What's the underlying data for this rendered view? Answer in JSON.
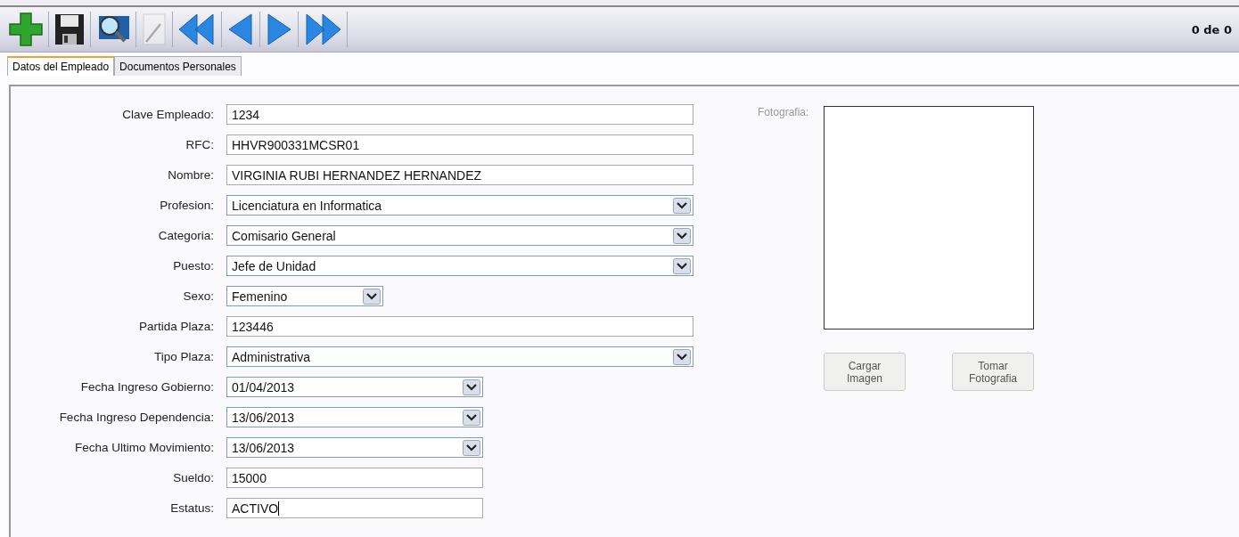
{
  "toolbar": {
    "buttons": [
      {
        "kind": "add",
        "disabled": false
      },
      {
        "kind": "save",
        "disabled": false
      },
      {
        "kind": "search",
        "disabled": false
      },
      {
        "kind": "edit",
        "disabled": true
      },
      {
        "kind": "first",
        "disabled": false
      },
      {
        "kind": "prev",
        "disabled": false
      },
      {
        "kind": "next",
        "disabled": false
      },
      {
        "kind": "last",
        "disabled": false
      }
    ],
    "record_counter": "0 de 0"
  },
  "tabs": [
    {
      "label": "Datos del Empleado",
      "selected": true
    },
    {
      "label": "Documentos Personales",
      "selected": false
    }
  ],
  "fields": [
    {
      "label": "Clave Empleado:",
      "value": "1234",
      "kind": "text",
      "focused": false
    },
    {
      "label": "RFC:",
      "value": "HHVR900331MCSR01",
      "kind": "text",
      "focused": false
    },
    {
      "label": "Nombre:",
      "value": "VIRGINIA RUBI HERNANDEZ HERNANDEZ",
      "kind": "text",
      "focused": false
    },
    {
      "label": "Profesion:",
      "value": "Licenciatura en Informatica",
      "kind": "combo"
    },
    {
      "label": "Categoria:",
      "value": "Comisario General",
      "kind": "combo"
    },
    {
      "label": "Puesto:",
      "value": "Jefe de Unidad",
      "kind": "combo"
    },
    {
      "label": "Sexo:",
      "value": "Femenino",
      "kind": "short-combo"
    },
    {
      "label": "Partida Plaza:",
      "value": "123446",
      "kind": "text",
      "focused": false
    },
    {
      "label": "Tipo Plaza:",
      "value": "Administrativa",
      "kind": "combo"
    },
    {
      "label": "Fecha Ingreso Gobierno:",
      "value": "01/04/2013",
      "kind": "date"
    },
    {
      "label": "Fecha Ingreso Dependencia:",
      "value": "13/06/2013",
      "kind": "date"
    },
    {
      "label": "Fecha Ultimo Movimiento:",
      "value": "13/06/2013",
      "kind": "date"
    },
    {
      "label": "Sueldo:",
      "value": "15000",
      "kind": "short-text",
      "focused": false
    },
    {
      "label": "Estatus:",
      "value": "ACTIVO",
      "kind": "short-text",
      "focused": true
    }
  ],
  "photo": {
    "label": "Fotografia:",
    "buttons": [
      "Cargar Imagen",
      "Tomar Fotografia"
    ]
  }
}
